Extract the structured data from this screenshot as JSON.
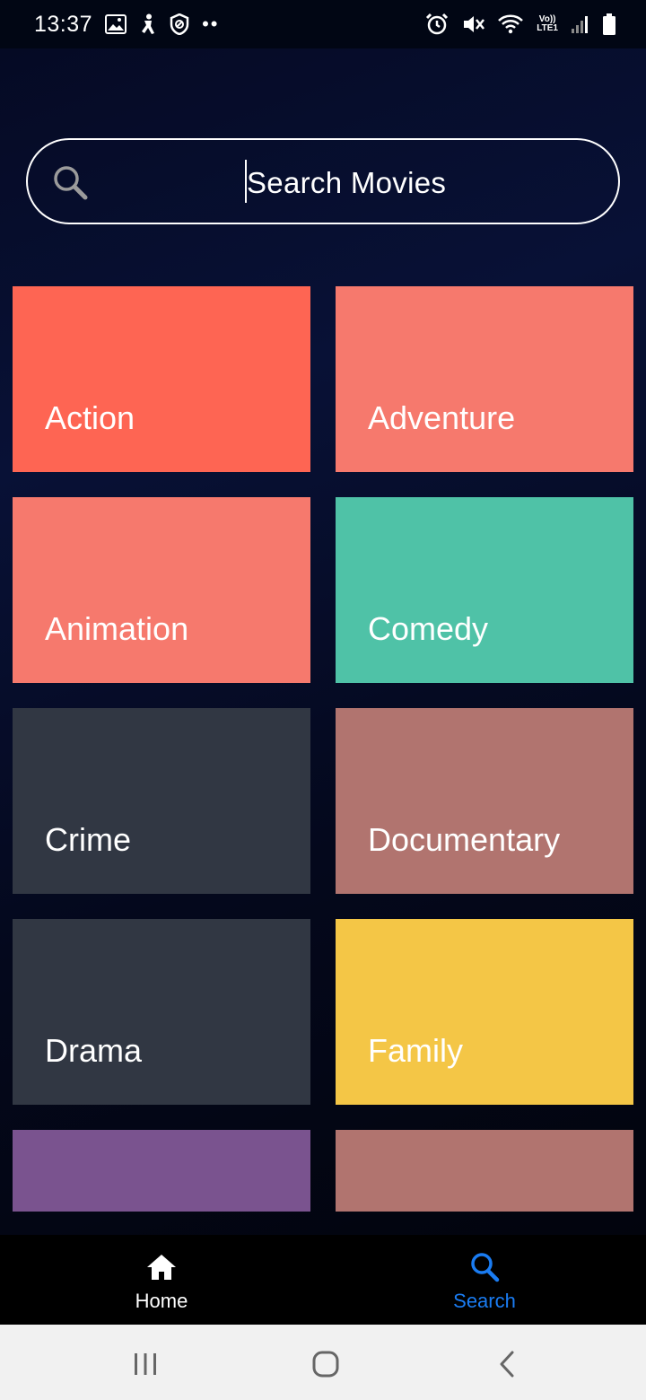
{
  "status_bar": {
    "time": "13:37",
    "left_icons": [
      "image-icon",
      "accessibility-icon",
      "shield-icon",
      "more-dots-icon"
    ],
    "more_dots": "••",
    "right_icons": [
      "alarm-icon",
      "mute-icon",
      "wifi-icon",
      "volte-icon",
      "signal-icon",
      "battery-icon"
    ],
    "volte_top": "Vo))",
    "volte_bottom": "LTE1"
  },
  "search": {
    "placeholder": "Search Movies",
    "icon": "search-icon"
  },
  "genres": [
    {
      "label": "Action",
      "color": "#fe6553"
    },
    {
      "label": "Adventure",
      "color": "#f6796d"
    },
    {
      "label": "Animation",
      "color": "#f6796d"
    },
    {
      "label": "Comedy",
      "color": "#4fc2a7"
    },
    {
      "label": "Crime",
      "color": "#313743"
    },
    {
      "label": "Documentary",
      "color": "#b1746f"
    },
    {
      "label": "Drama",
      "color": "#313743"
    },
    {
      "label": "Family",
      "color": "#f4c646"
    },
    {
      "label": "",
      "color": "#7a538f"
    },
    {
      "label": "",
      "color": "#b1746f"
    }
  ],
  "bottom_nav": {
    "items": [
      {
        "label": "Home",
        "icon": "home-icon",
        "active": false
      },
      {
        "label": "Search",
        "icon": "search-icon",
        "active": true
      }
    ],
    "active_color": "#1a7cf2",
    "inactive_color": "#ffffff"
  },
  "system_nav": {
    "buttons": [
      "recents-icon",
      "home-circle-icon",
      "back-icon"
    ]
  }
}
